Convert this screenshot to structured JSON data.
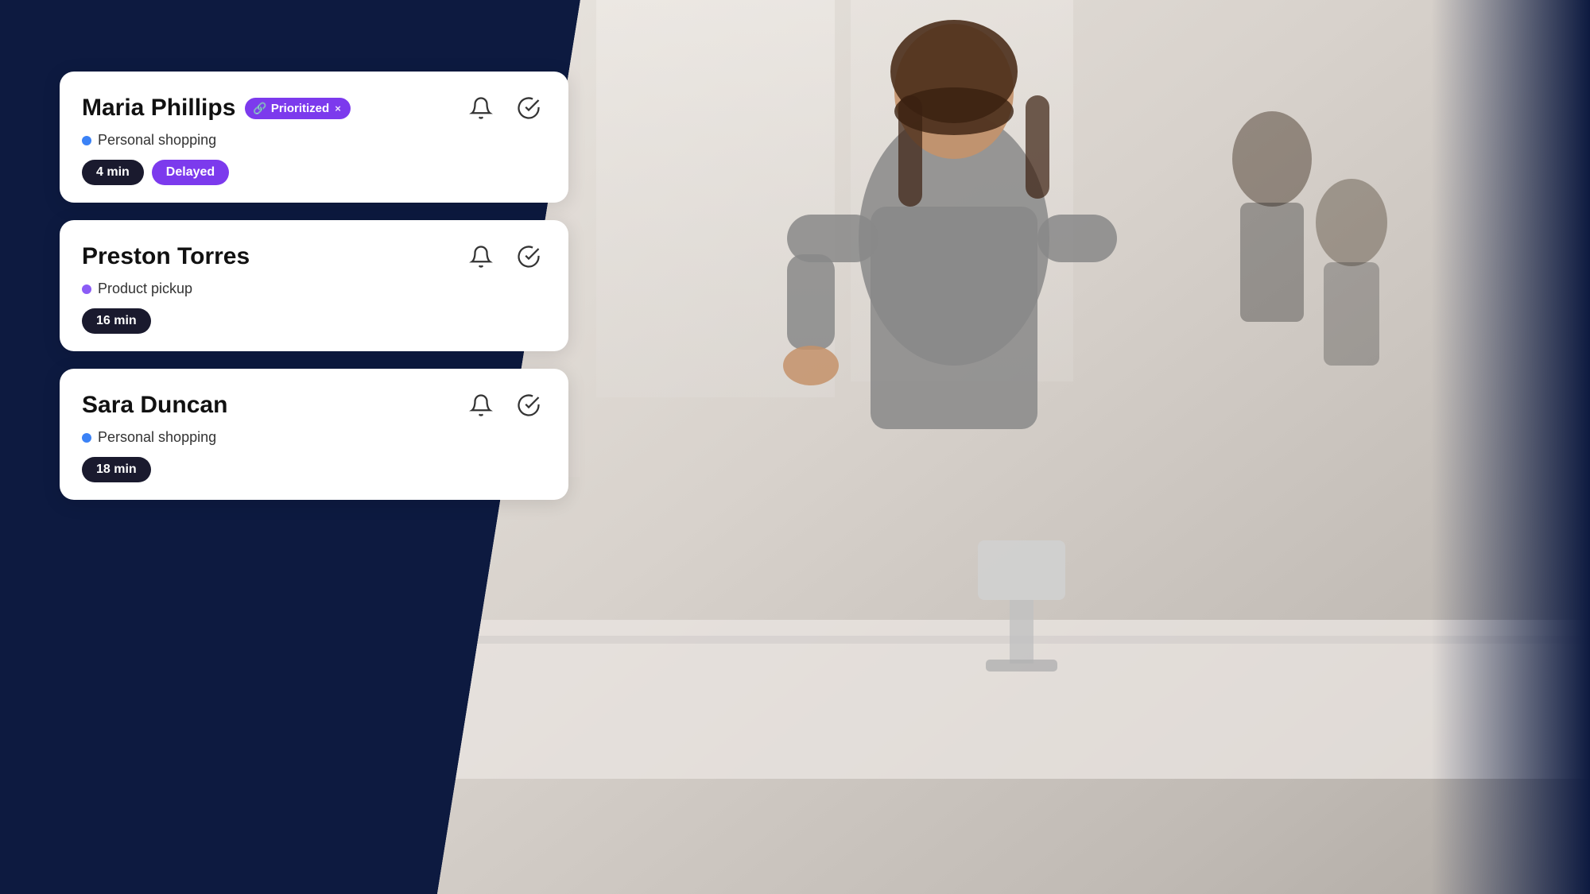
{
  "background": {
    "dark_color": "#0d1a40",
    "light_color": "#d4cec8"
  },
  "cards": [
    {
      "id": "card-maria",
      "customer_name": "Maria Phillips",
      "badge_label": "Prioritized",
      "badge_close": "×",
      "service_dot_color": "#3b82f6",
      "service_dot_class": "dot-blue",
      "service_label": "Personal shopping",
      "time_tag": "4 min",
      "status_tag": "Delayed",
      "has_status_tag": true,
      "bell_title": "notification bell",
      "check_title": "mark complete"
    },
    {
      "id": "card-preston",
      "customer_name": "Preston Torres",
      "badge_label": null,
      "service_dot_color": "#8b5cf6",
      "service_dot_class": "dot-purple",
      "service_label": "Product pickup",
      "time_tag": "16 min",
      "status_tag": null,
      "has_status_tag": false,
      "bell_title": "notification bell",
      "check_title": "mark complete"
    },
    {
      "id": "card-sara",
      "customer_name": "Sara Duncan",
      "badge_label": null,
      "service_dot_color": "#3b82f6",
      "service_dot_class": "dot-blue",
      "service_label": "Personal shopping",
      "time_tag": "18 min",
      "status_tag": null,
      "has_status_tag": false,
      "bell_title": "notification bell",
      "check_title": "mark complete"
    }
  ]
}
